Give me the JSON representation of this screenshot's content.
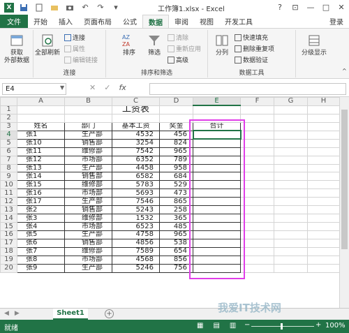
{
  "window": {
    "title": "工作簿1.xlsx - Excel",
    "help": "?",
    "minimize": "—",
    "maximize": "□",
    "close": "✕"
  },
  "tabs": [
    "文件",
    "开始",
    "插入",
    "页面布局",
    "公式",
    "数据",
    "审阅",
    "视图",
    "开发工具"
  ],
  "login": "登录",
  "ribbon": {
    "get_external": "获取\n外部数据",
    "refresh_all": "全部刷新",
    "connections": "连接",
    "properties": "属性",
    "edit_links": "编辑链接",
    "group_connections": "连接",
    "sort": "排序",
    "filter": "筛选",
    "clear": "清除",
    "reapply": "重新应用",
    "advanced": "高级",
    "group_sortfilter": "排序和筛选",
    "text_to_columns": "分列",
    "flash_fill": "快速填充",
    "remove_dup": "删除重复项",
    "data_validation": "数据验证",
    "group_datatools": "数据工具",
    "outline": "分级显示"
  },
  "formula_bar": {
    "name_box": "E4",
    "cancel": "✕",
    "enter": "✓",
    "fx": "fx",
    "value": ""
  },
  "sheet": {
    "columns": [
      "A",
      "B",
      "C",
      "D",
      "E",
      "F",
      "G",
      "H"
    ],
    "title": "工资表",
    "headers": [
      "姓名",
      "部门",
      "基本工资",
      "奖金",
      "合计"
    ],
    "rows": [
      [
        "张1",
        "生产部",
        "4532",
        "456"
      ],
      [
        "张10",
        "销售部",
        "3254",
        "824"
      ],
      [
        "张11",
        "维修部",
        "7542",
        "965"
      ],
      [
        "张12",
        "市场部",
        "6352",
        "789"
      ],
      [
        "张13",
        "生产部",
        "4458",
        "958"
      ],
      [
        "张14",
        "销售部",
        "6582",
        "684"
      ],
      [
        "张15",
        "维修部",
        "5783",
        "529"
      ],
      [
        "张16",
        "市场部",
        "5693",
        "473"
      ],
      [
        "张17",
        "生产部",
        "7546",
        "865"
      ],
      [
        "张2",
        "销售部",
        "5243",
        "258"
      ],
      [
        "张3",
        "维修部",
        "1532",
        "365"
      ],
      [
        "张4",
        "市场部",
        "6523",
        "485"
      ],
      [
        "张5",
        "生产部",
        "4758",
        "965"
      ],
      [
        "张6",
        "销售部",
        "4856",
        "538"
      ],
      [
        "张7",
        "维修部",
        "7589",
        "654"
      ],
      [
        "张8",
        "市场部",
        "4568",
        "856"
      ],
      [
        "张9",
        "生产部",
        "5246",
        "756"
      ]
    ]
  },
  "sheet_tab": "Sheet1",
  "status": {
    "ready": "就绪",
    "zoom": "100%",
    "zoom_minus": "−",
    "zoom_plus": "+"
  },
  "watermark": "我爱IT技术网",
  "colors": {
    "excel_green": "#217346",
    "highlight": "#e03ee8"
  }
}
